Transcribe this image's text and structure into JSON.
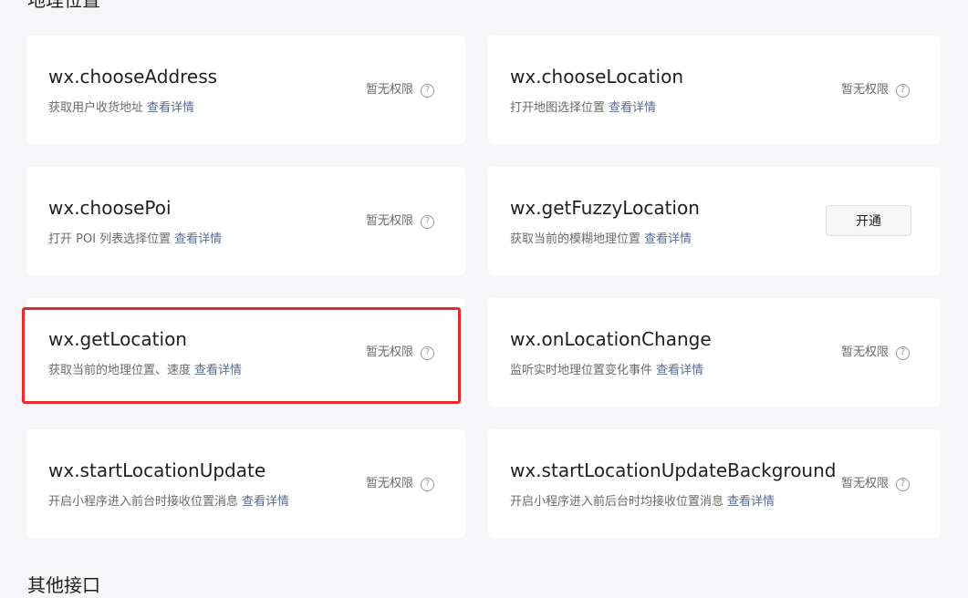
{
  "section_location_title": "地理位置",
  "section_other_title": "其他接口",
  "detail_link_label": "查看详情",
  "accent_color": "#576b95",
  "highlight_color": "#e8292e",
  "cards": [
    {
      "name": "wx.chooseAddress",
      "desc": "获取用户收货地址",
      "status": "暂无权限",
      "icon": "help-circle-icon"
    },
    {
      "name": "wx.chooseLocation",
      "desc": "打开地图选择位置",
      "status": "暂无权限",
      "icon": "help-circle-icon"
    },
    {
      "name": "wx.choosePoi",
      "desc": "打开 POI 列表选择位置",
      "status": "暂无权限",
      "icon": "help-circle-icon"
    },
    {
      "name": "wx.getFuzzyLocation",
      "desc": "获取当前的模糊地理位置",
      "button": "开通"
    },
    {
      "name": "wx.getLocation",
      "desc": "获取当前的地理位置、速度",
      "status": "暂无权限",
      "icon": "help-circle-icon",
      "highlighted": true
    },
    {
      "name": "wx.onLocationChange",
      "desc": "监听实时地理位置变化事件",
      "status": "暂无权限",
      "icon": "help-circle-icon"
    },
    {
      "name": "wx.startLocationUpdate",
      "desc": "开启小程序进入前台时接收位置消息",
      "status": "暂无权限",
      "icon": "help-circle-icon"
    },
    {
      "name": "wx.startLocationUpdateBackground",
      "desc": "开启小程序进入前后台时均接收位置消息",
      "status": "暂无权限",
      "icon": "help-circle-icon"
    }
  ]
}
